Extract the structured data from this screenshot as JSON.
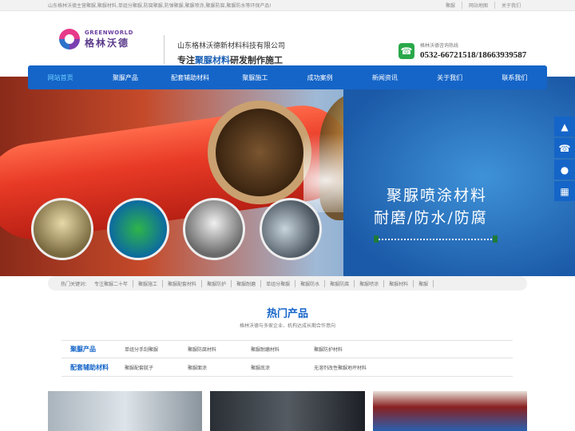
{
  "topbar": {
    "intro": "山东格林沃德主营聚脲,聚脲材料,单组分聚脲,防腐聚脲,防弹聚脲,聚脲喷涂,聚脲防腐,聚脲防水等环保产品!",
    "links": [
      "聚脲",
      "网站地图",
      "关于我们"
    ]
  },
  "logo": {
    "en": "GREENWORLD",
    "cn": "格林沃德"
  },
  "company": {
    "name": "山东格林沃德新材料科技有限公司",
    "slogan_pre": "专注",
    "slogan_em": "聚脲材料",
    "slogan_post": "研发制作施工"
  },
  "hotline": {
    "label": "格林沃德咨询热线",
    "number": "0532-66721518/18663939587"
  },
  "nav": {
    "items": [
      "网站首页",
      "聚脲产品",
      "配套辅助材料",
      "聚脲施工",
      "成功案例",
      "新闻资讯",
      "关于我们",
      "联系我们"
    ],
    "active_index": 0
  },
  "banner": {
    "title": "聚脲喷涂材料",
    "subtitle": "耐磨/防水/防腐"
  },
  "keywords": {
    "label": "热门关键词：",
    "items": [
      "专注聚脲二十年",
      "聚脲施工",
      "聚脲配套材料",
      "聚脲防护",
      "聚脲耐磨",
      "单组分聚脲",
      "聚脲防水",
      "聚脲防腐",
      "聚脲喷涂",
      "聚脲材料",
      "聚脲"
    ]
  },
  "hot": {
    "title": "热门产品",
    "subtitle": "格林沃德与多家企业、机构达成长期合作意向"
  },
  "categories": [
    {
      "name": "聚脲产品",
      "items": [
        "单组分手刮聚脲",
        "聚脲防腐材料",
        "聚脲耐磨材料",
        "聚脲防护材料"
      ]
    },
    {
      "name": "配套辅助材料",
      "items": [
        "聚脲配套腻子",
        "聚脲面涂",
        "聚脲底涂",
        "无溶剂改性聚脲地坪材料"
      ]
    }
  ],
  "colors": {
    "nav": "#1565c8",
    "accent": "#1565c8",
    "phone": "#2aa84a"
  }
}
